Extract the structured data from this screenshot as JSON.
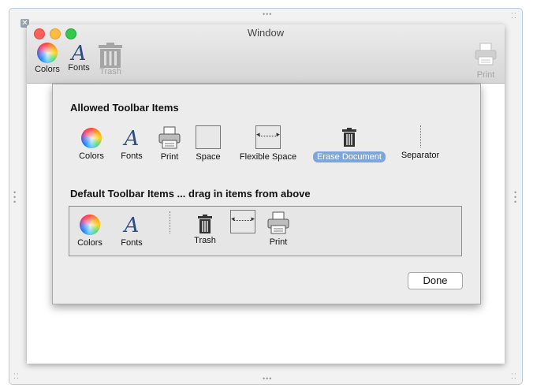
{
  "window": {
    "title": "Window",
    "toolbar": [
      {
        "label": "Colors",
        "icon": "color-wheel-icon"
      },
      {
        "label": "Fonts",
        "icon": "font-icon"
      },
      {
        "label": "Trash",
        "icon": "trash-icon",
        "disabled": true
      },
      {
        "label": "Print",
        "icon": "print-icon",
        "disabled": true
      }
    ],
    "traffic_lights": {
      "close": "#fc605c",
      "minimize": "#fdbc40",
      "zoom": "#34c84a"
    }
  },
  "sheet": {
    "allowed_title": "Allowed Toolbar Items",
    "allowed_items": [
      {
        "label": "Colors",
        "icon": "color-wheel-icon"
      },
      {
        "label": "Fonts",
        "icon": "font-icon"
      },
      {
        "label": "Print",
        "icon": "print-icon"
      },
      {
        "label": "Space",
        "icon": "space-icon"
      },
      {
        "label": "Flexible Space",
        "icon": "flexible-space-icon"
      },
      {
        "label": "Erase Document",
        "icon": "trash-icon",
        "selected": true
      },
      {
        "label": "Separator",
        "icon": "separator-icon"
      }
    ],
    "default_title": "Default Toolbar Items ... drag in items from above",
    "default_items": [
      {
        "label": "Colors",
        "icon": "color-wheel-icon"
      },
      {
        "label": "Fonts",
        "icon": "font-icon"
      },
      {
        "label": "",
        "icon": "separator-icon"
      },
      {
        "label": "Trash",
        "icon": "trash-icon"
      },
      {
        "label": "",
        "icon": "flexible-space-icon"
      },
      {
        "label": "Print",
        "icon": "print-icon"
      }
    ],
    "done_label": "Done"
  },
  "colors": {
    "selection": "#7fa6d8",
    "font_icon": "#2b4b8a"
  }
}
